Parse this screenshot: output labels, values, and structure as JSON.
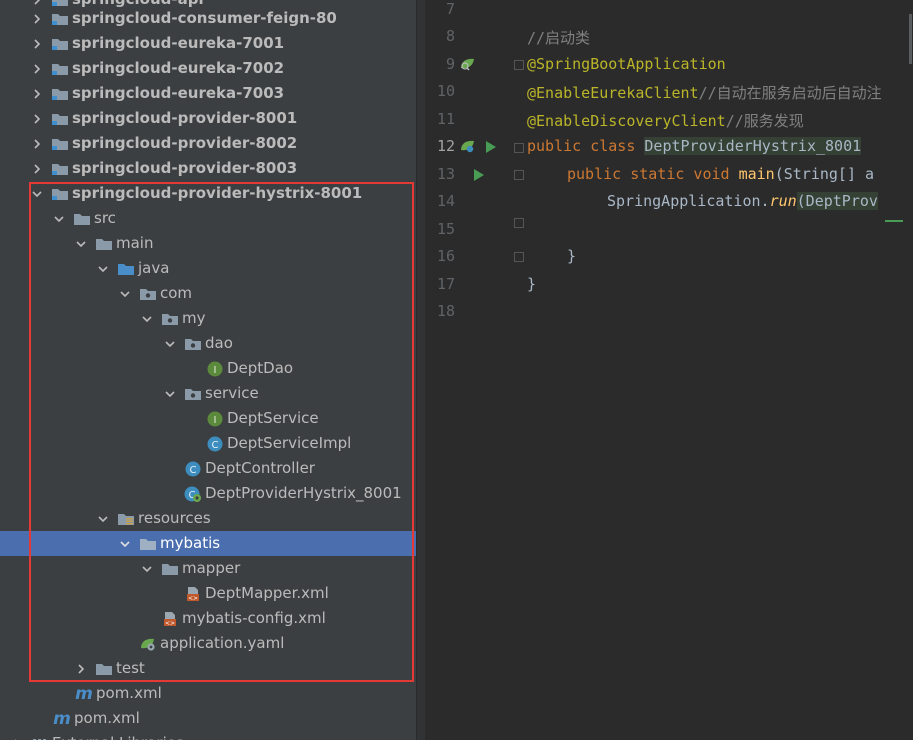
{
  "project_tree": {
    "top_partial": "springcloud-api",
    "modules": [
      "springcloud-consumer-feign-80",
      "springcloud-eureka-7001",
      "springcloud-eureka-7002",
      "springcloud-eureka-7003",
      "springcloud-provider-8001",
      "springcloud-provider-8002",
      "springcloud-provider-8003"
    ],
    "open_module": "springcloud-provider-hystrix-8001",
    "src": "src",
    "main": "main",
    "java": "java",
    "com": "com",
    "my": "my",
    "dao": "dao",
    "dept_dao": "DeptDao",
    "service": "service",
    "dept_service": "DeptService",
    "dept_service_impl": "DeptServiceImpl",
    "dept_controller": "DeptController",
    "main_class": "DeptProviderHystrix_8001",
    "resources": "resources",
    "mybatis": "mybatis",
    "mapper": "mapper",
    "dept_mapper_xml": "DeptMapper.xml",
    "mybatis_config": "mybatis-config.xml",
    "application_yaml": "application.yaml",
    "test": "test",
    "module_pom": "pom.xml",
    "root_pom": "pom.xml",
    "external_libraries": "External Libraries"
  },
  "editor": {
    "line_numbers": [
      "7",
      "8",
      "9",
      "10",
      "11",
      "12",
      "13",
      "14",
      "15",
      "16",
      "17",
      "18"
    ],
    "current_line": "12",
    "lines": {
      "l8_comment": "//启动类",
      "l9_annotation": "@SpringBootApplication",
      "l10_annotation": "@EnableEurekaClient",
      "l10_comment": "//自动在服务启动后自动注",
      "l11_annotation": "@EnableDiscoveryClient",
      "l11_comment": "//服务发现",
      "l12_public": "public",
      "l12_class": "class",
      "l12_name": "DeptProviderHystrix_8001",
      "l13_mods": "public static void",
      "l13_method": "main",
      "l13_params": "(String[] a",
      "l14_call_class": "SpringApplication.",
      "l14_call_method": "run",
      "l14_args": "(DeptProv",
      "l16_brace": "}",
      "l17_brace": "}"
    }
  },
  "colors": {
    "tree_bg": "#3c3f41",
    "editor_bg": "#2b2b2b",
    "selection": "#4b6eaf",
    "highlight_box": "#e53935",
    "keyword": "#cc7832",
    "annotation": "#bbb529",
    "comment": "#808080",
    "method": "#ffc66d"
  }
}
